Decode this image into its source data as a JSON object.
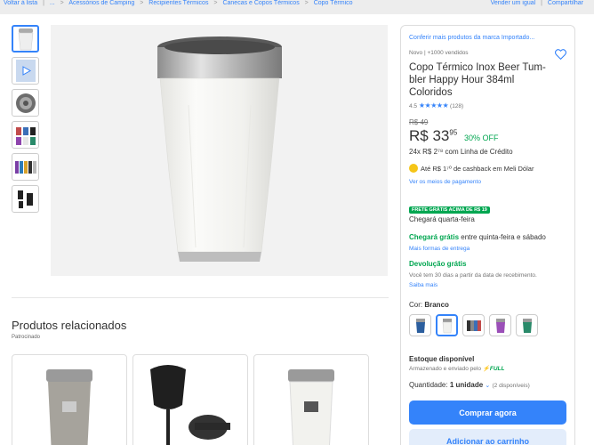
{
  "topbar": {
    "back": "Voltar à lista",
    "sep": "|",
    "crumbs": [
      "...",
      "Acessórios de Camping",
      "Recipientes Térmicos",
      "Canecas e Copos Térmicos",
      "Copo Térmico"
    ],
    "crumb_sep": ">",
    "sell_similar": "Vender um igual",
    "share": "Compartilhar"
  },
  "product": {
    "brand_link": "Conferir mais produtos da marca Importado...",
    "condition": "Novo  |  +1000 vendidos",
    "title_line1": "Copo Térmico Inox Beer Tum-",
    "title_line2": "bler Happy Hour 384ml",
    "title_line3": "Coloridos",
    "rating": "4.5",
    "stars": "★★★★★",
    "reviews": "(128)",
    "old_price": "R$ 49",
    "price_main": "R$ 33",
    "price_cents": "95",
    "discount": "30% OFF",
    "installments": "24x R$ 2⁷⁸ com Linha de Crédito",
    "cashback": "Até R$ 1⁷⁰ de cashback em Meli Dólar",
    "payment_link": "Ver os meios de pagamento"
  },
  "shipping": {
    "badge": "FRETE GRÁTIS ACIMA DE R$ 19",
    "arrives": "Chegará quarta-feira",
    "free_arrives_green": "Chegará grátis",
    "free_arrives_rest": " entre quinta-feira e sábado",
    "more_link": "Mais formas de entrega"
  },
  "returns": {
    "title": "Devolução grátis",
    "text": "Você tem 30 dias a partir da data de recebimento.",
    "link": "Saiba mais"
  },
  "variant": {
    "label": "Cor: ",
    "value": "Branco"
  },
  "stock": {
    "title": "Estoque disponível",
    "stored": "Armazenado e enviado pelo",
    "full": "FULL",
    "qty_label": "Quantidade: ",
    "qty_value": "1 unidade",
    "qty_available": "(2 disponíveis)"
  },
  "buttons": {
    "buy": "Comprar agora",
    "cart": "Adicionar ao carrinho"
  },
  "related": {
    "title": "Produtos relacionados",
    "sponsored": "Patrocinado"
  },
  "colors": {
    "accent": "#3483fa",
    "green": "#00a650"
  }
}
